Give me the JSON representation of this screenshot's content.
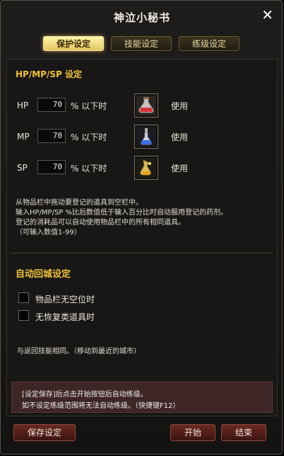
{
  "window": {
    "title": "神泣小秘书",
    "close_label": "✕"
  },
  "tabs": [
    {
      "label": "保护设定",
      "active": true
    },
    {
      "label": "技能设定",
      "active": false
    },
    {
      "label": "练级设定",
      "active": false
    }
  ],
  "protection": {
    "section_title": "HP/MP/SP 设定",
    "rows": [
      {
        "label": "HP",
        "value": "70",
        "suffix": "% 以下时",
        "item_icon": "hp-potion-icon",
        "use_label": "使用"
      },
      {
        "label": "MP",
        "value": "70",
        "suffix": "% 以下时",
        "item_icon": "mp-potion-icon",
        "use_label": "使用"
      },
      {
        "label": "SP",
        "value": "70",
        "suffix": "% 以下时",
        "item_icon": "sp-potion-icon",
        "use_label": "使用"
      }
    ],
    "description": [
      "从物品栏中拖动要登记的道具到空栏中。",
      "输入HP/MP/SP %比后数值低于输入百分比时自动服用登记的药剂。",
      "登记的消耗品可以自动使用物品栏中的所有相同道具。",
      "（可输入数值1-99）"
    ]
  },
  "auto_return": {
    "section_title": "自动回城设定",
    "options": [
      {
        "label": "物品栏无空位时",
        "checked": false
      },
      {
        "label": "无恢复类道具时",
        "checked": false
      }
    ],
    "note": "与返回技能相同。（移动到最近的城市）"
  },
  "notice": {
    "line1": "[设定保存]后点击开始按钮后自动练级。",
    "line2": "如不设定练级范围将无法自动练级。（快捷键F12）"
  },
  "buttons": {
    "save": "保存设定",
    "start": "开始",
    "end": "结束"
  },
  "colors": {
    "accent": "#f0c040",
    "tab_active": "#f3dc80",
    "button_bg": "#5a2018",
    "notice_bg": "#3e2626"
  }
}
